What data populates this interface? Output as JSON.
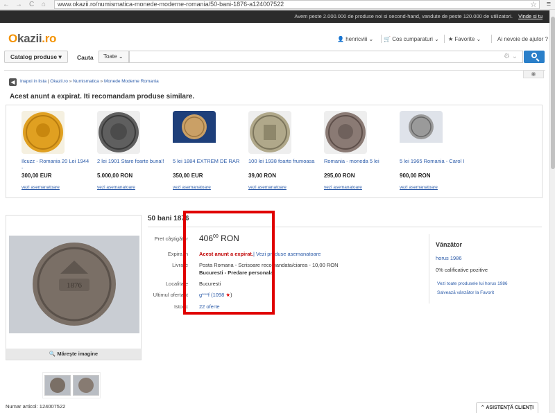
{
  "browser": {
    "url": "www.okazii.ro/numismatica-monede-moderne-romania/50-bani-1876-a124007522",
    "nav_back": "←",
    "nav_forward": "→",
    "nav_reload": "C",
    "nav_home": "⌂"
  },
  "top_strip": {
    "text": "Avem peste 2.000.000 de produse noi si second-hand, vandute de peste 120.000 de utilizatori.",
    "link": "Vinde si tu"
  },
  "header": {
    "logo_main": "kazii",
    "logo_o": "O",
    "logo_suffix": ".ro",
    "user": "henricviii",
    "purchases": "Cos cumparaturi",
    "favorites": "Favorite",
    "help": "Ai nevoie de ajutor ?"
  },
  "search": {
    "catalog_label": "Catalog produse",
    "cauta_label": "Cauta",
    "category": "Toate",
    "query": ""
  },
  "breadcrumb": {
    "back": "Inapoi in lista",
    "items": [
      "Okazii.ro",
      "Numismatica",
      "Monede Moderne Romania"
    ]
  },
  "expired_heading": "Acest anunt a expirat. Iti recomandam produse similare.",
  "similar_products": [
    {
      "title": "Ilcuzz - Romania 20 Lei 1944 -",
      "price": "300,00 EUR",
      "similar": "vezi asemanatoare",
      "color": "#e0a021"
    },
    {
      "title": "2 lei 1901 Stare foarte buna!!",
      "price": "5.000,00 RON",
      "similar": "vezi asemanatoare",
      "color": "#6a6a6a"
    },
    {
      "title": "5 lei 1884 EXTREM DE RAR",
      "price": "350,00 EUR",
      "similar": "vezi asemanatoare",
      "color": "#caa066"
    },
    {
      "title": "100 lei 1938 foarte frumoasa",
      "price": "39,00 RON",
      "similar": "vezi asemanatoare",
      "color": "#b0a88a"
    },
    {
      "title": "Romania - moneda 5 lei",
      "price": "295,00 RON",
      "similar": "vezi asemanatoare",
      "color": "#8a7a74"
    },
    {
      "title": "5 lei 1965 Romania - Carol I",
      "price": "900,00 RON",
      "similar": "vezi asemanatoare",
      "color": "#9a9a9a"
    }
  ],
  "product": {
    "title": "50 bani 1876",
    "zoom_label": "Măreşte imagine",
    "price_label": "Pret câştigător",
    "price_int": "406",
    "price_dec": "00",
    "currency": "RON",
    "expires_label": "Expira in",
    "expired_text": "Acest anunt a expirat.",
    "view_similar": "Vezi produse asemanatoare",
    "delivery_label": "Livrare",
    "delivery_text": "Posta Romana - Scrisoare recomandata/ciarea - 10,00 RON",
    "delivery_text2": "Bucuresti - Predare personala",
    "location_label": "Localitate",
    "location": "Bucuresti",
    "last_bidder_label": "Ultimul ofertant",
    "last_bidder": "g***f (1098",
    "last_bidder_end": ")",
    "history_label": "Istoric",
    "history": "22 oferte",
    "article_label": "Numar articol:",
    "article_number": "124007522"
  },
  "seller": {
    "title": "Vânzător",
    "name": "horus 1986",
    "rating": "0% calificative pozitive",
    "link_products": "Vezi toate produsele lui horus 1986",
    "link_favorite": "Salvează vânzător la Favorit"
  },
  "help_button": "ASISTENŢĂ CLIENŢI"
}
